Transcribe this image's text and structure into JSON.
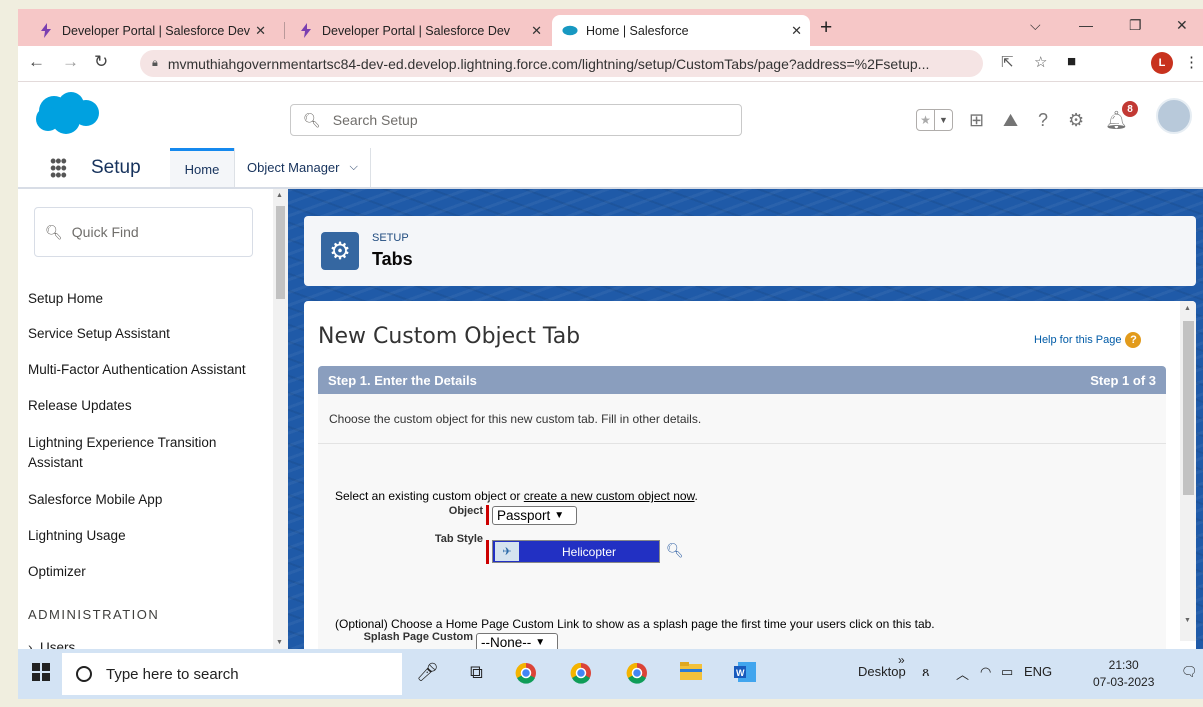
{
  "browser": {
    "tabs": [
      {
        "title": "Developer Portal | Salesforce Dev",
        "icon": "bolt-icon"
      },
      {
        "title": "Developer Portal | Salesforce Dev",
        "icon": "bolt-icon"
      },
      {
        "title": "Home | Salesforce",
        "icon": "salesforce-icon"
      }
    ],
    "url": "mvmuthiahgovernmentartsc84-dev-ed.develop.lightning.force.com/lightning/setup/CustomTabs/page?address=%2Fsetup...",
    "profile_initial": "L"
  },
  "sf_header": {
    "search_placeholder": "Search Setup",
    "notification_count": "8"
  },
  "setup_nav": {
    "app_name": "Setup",
    "tabs": [
      {
        "label": "Home"
      },
      {
        "label": "Object Manager"
      }
    ]
  },
  "sidebar": {
    "quick_find_placeholder": "Quick Find",
    "items": [
      "Setup Home",
      "Service Setup Assistant",
      "Multi-Factor Authentication Assistant",
      "Release Updates",
      "Lightning Experience Transition Assistant",
      "Salesforce Mobile App",
      "Lightning Usage",
      "Optimizer"
    ],
    "section_heading": "ADMINISTRATION",
    "section_items": [
      "Users"
    ]
  },
  "page_header": {
    "breadcrumb": "SETUP",
    "title": "Tabs"
  },
  "content": {
    "title": "New Custom Object Tab",
    "help_link": "Help for this Page",
    "step_label": "Step 1. Enter the Details",
    "step_count": "Step 1 of 3",
    "step_description": "Choose the custom object for this new custom tab. Fill in other details.",
    "select_text": "Select an existing custom object or",
    "create_link": "create a new custom object now",
    "select_text_end": ".",
    "object_label": "Object",
    "object_value": "Passport",
    "tab_style_label": "Tab Style",
    "tab_style_value": "Helicopter",
    "splash_text": "(Optional) Choose a Home Page Custom Link to show as a splash page the first time your users click on this tab.",
    "splash_label": "Splash Page Custom",
    "splash_value": "--None--"
  },
  "taskbar": {
    "search_placeholder": "Type here to search",
    "desktop_label": "Desktop",
    "language": "ENG",
    "time": "21:30",
    "date": "07-03-2023"
  },
  "colors": {
    "tabstrip": "#f6c7c7",
    "setup_bg": "#1f5aa8",
    "step_bar": "#8a9ebe",
    "tab_style": "#2230c3",
    "accent": "#1589ee"
  }
}
